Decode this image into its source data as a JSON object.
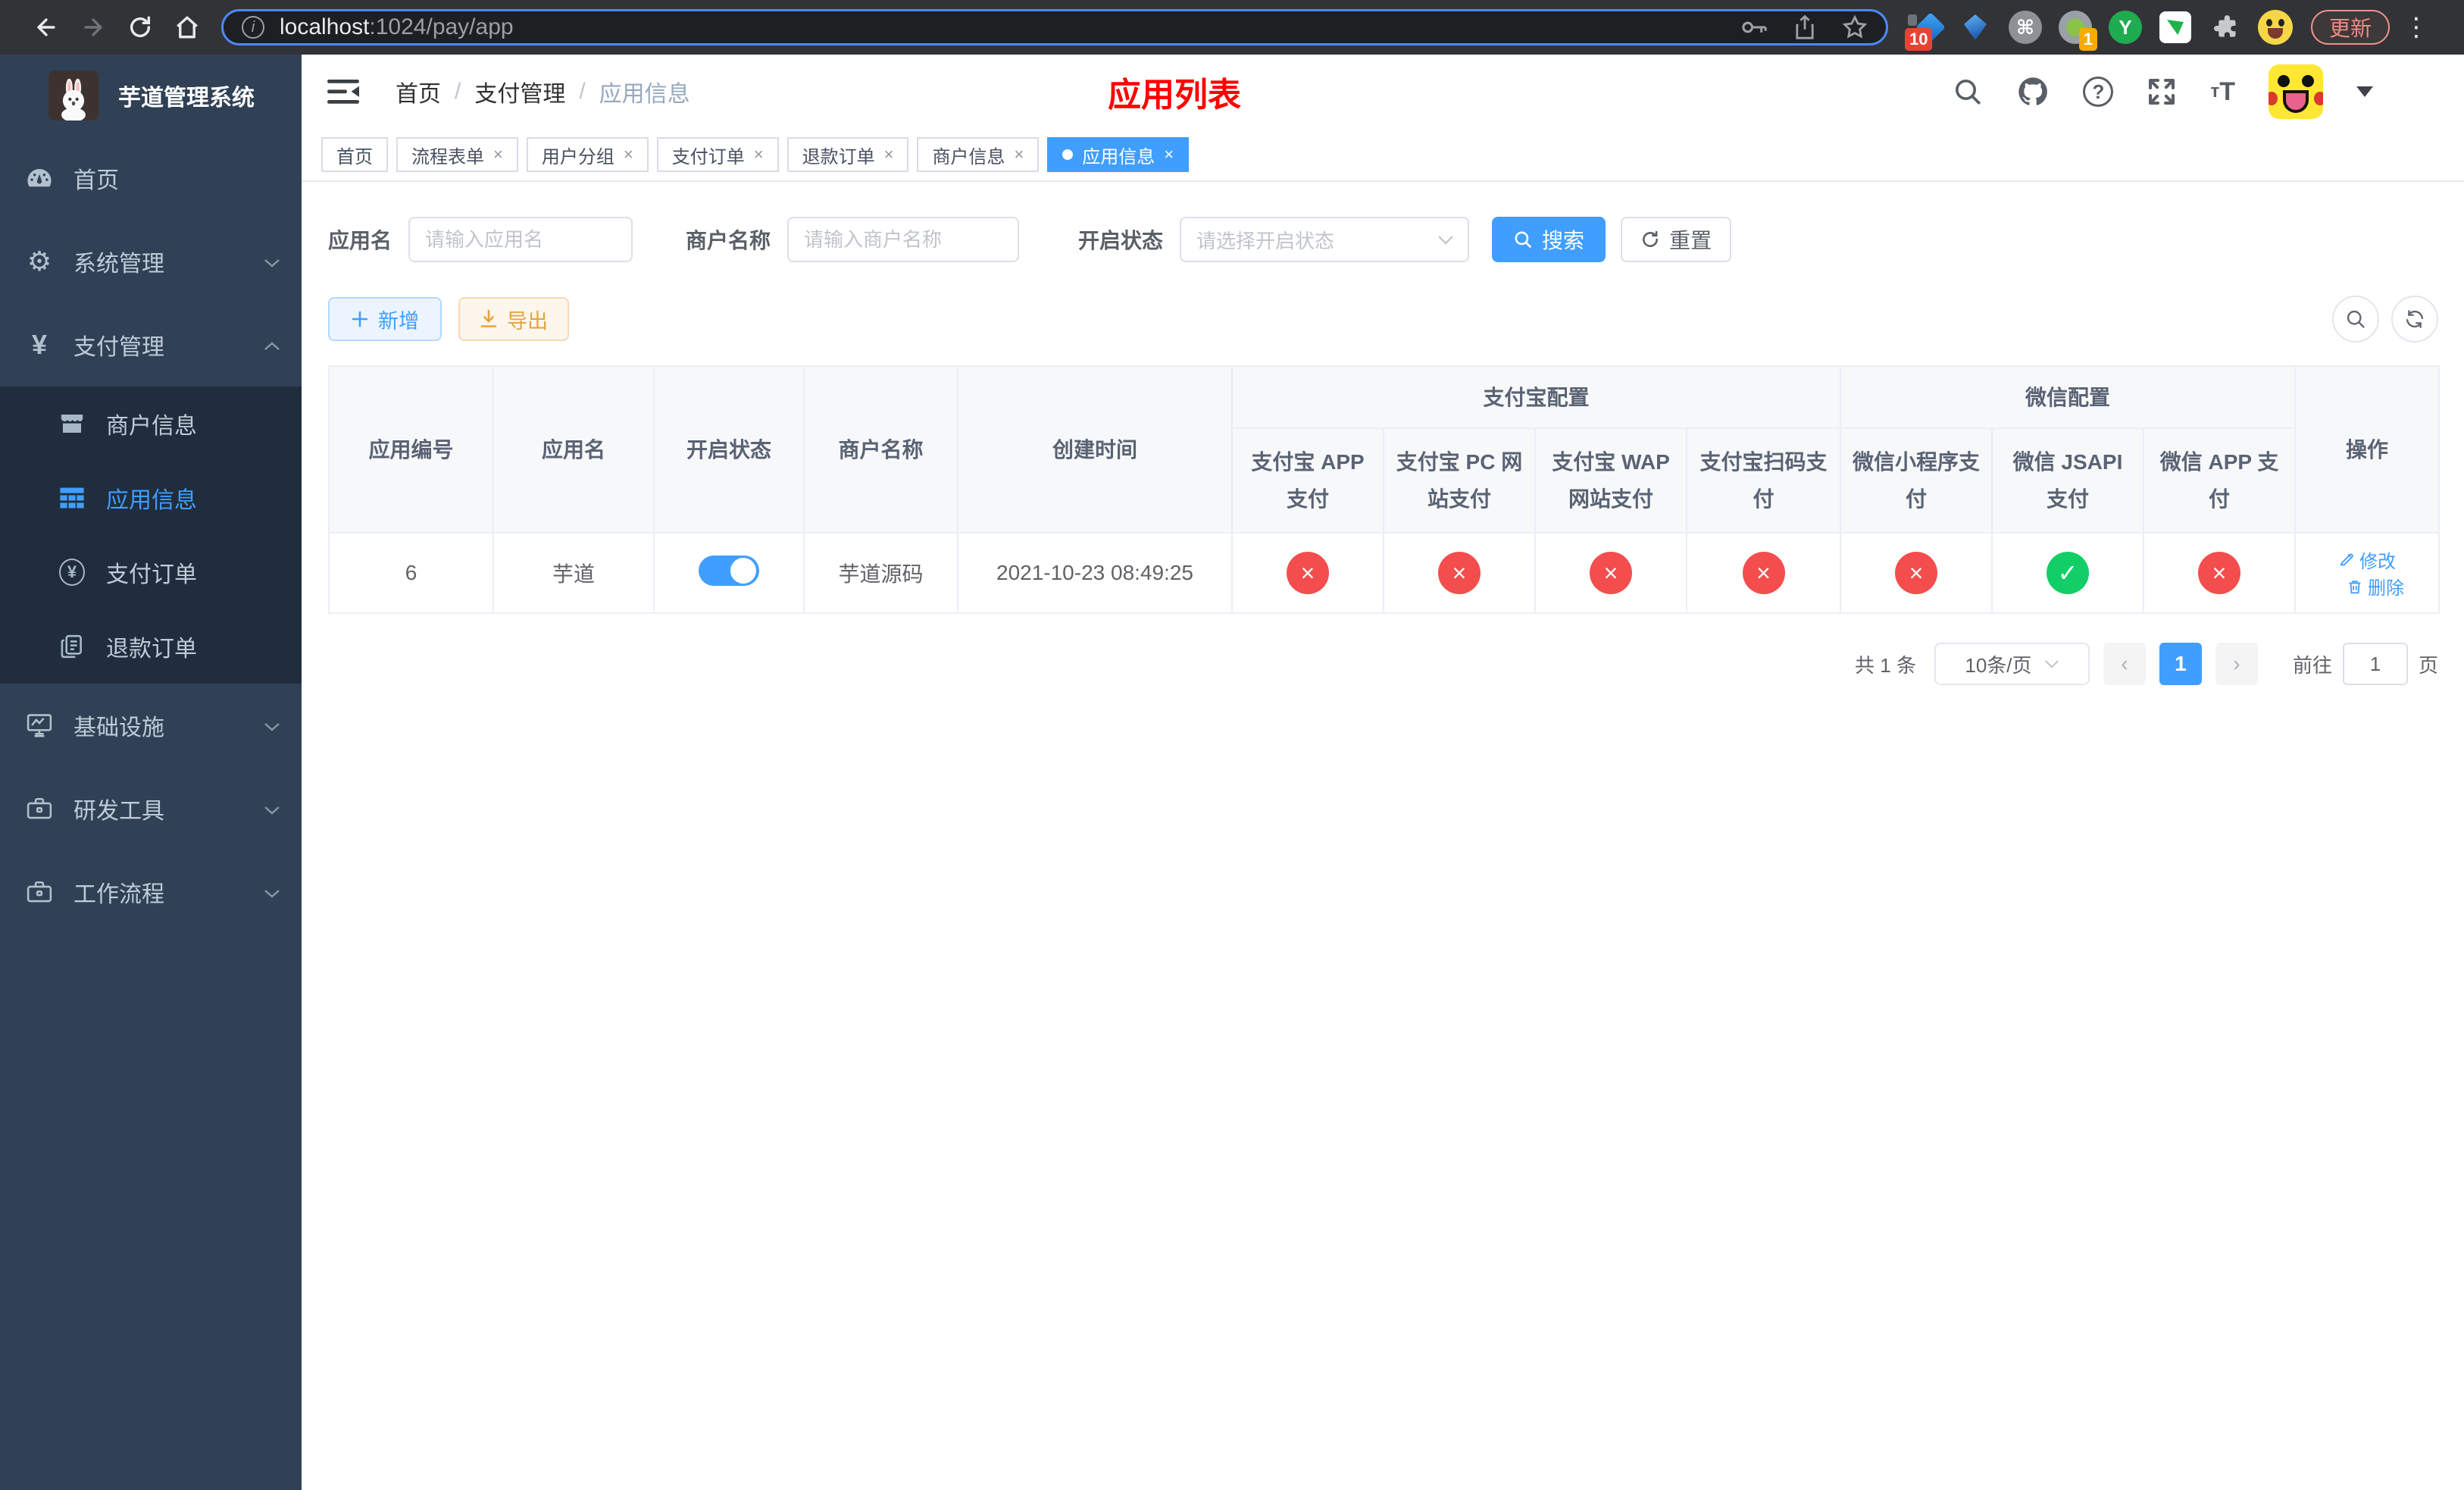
{
  "browser": {
    "url_host": "localhost",
    "url_path": ":1024/pay/app",
    "update_label": "更新",
    "badge_ten": "10",
    "badge_one": "1"
  },
  "sidebar": {
    "title": "芋道管理系统",
    "items": {
      "home": "首页",
      "system": "系统管理",
      "payment": "支付管理",
      "merchant": "商户信息",
      "app_info": "应用信息",
      "pay_order": "支付订单",
      "refund_order": "退款订单",
      "infra": "基础设施",
      "dev_tools": "研发工具",
      "workflow": "工作流程"
    }
  },
  "navbar": {
    "breadcrumb": {
      "home": "首页",
      "payment": "支付管理",
      "current": "应用信息",
      "sep": "/"
    },
    "title": "应用列表"
  },
  "tabs": {
    "items": [
      {
        "label": "首页"
      },
      {
        "label": "流程表单"
      },
      {
        "label": "用户分组"
      },
      {
        "label": "支付订单"
      },
      {
        "label": "退款订单"
      },
      {
        "label": "商户信息"
      },
      {
        "label": "应用信息"
      }
    ],
    "close": "×"
  },
  "filters": {
    "app_name_label": "应用名",
    "app_name_placeholder": "请输入应用名",
    "merchant_label": "商户名称",
    "merchant_placeholder": "请输入商户名称",
    "status_label": "开启状态",
    "status_placeholder": "请选择开启状态",
    "search": "搜索",
    "reset": "重置"
  },
  "toolbar": {
    "add": "新增",
    "export": "导出"
  },
  "table": {
    "groups": {
      "alipay": "支付宝配置",
      "wechat": "微信配置"
    },
    "columns": {
      "app_id": "应用编号",
      "app_name": "应用名",
      "status": "开启状态",
      "merchant": "商户名称",
      "created": "创建时间",
      "alipay_app": "支付宝 APP 支付",
      "alipay_pc": "支付宝 PC 网站支付",
      "alipay_wap": "支付宝 WAP 网站支付",
      "alipay_qr": "支付宝扫码支付",
      "wx_mini": "微信小程序支付",
      "wx_jsapi": "微信 JSAPI 支付",
      "wx_app": "微信 APP 支付",
      "actions": "操作"
    },
    "row": {
      "app_id": "6",
      "app_name": "芋道",
      "enabled": true,
      "merchant": "芋道源码",
      "created": "2021-10-23 08:49:25",
      "statuses": {
        "alipay_app": "fail",
        "alipay_pc": "fail",
        "alipay_wap": "fail",
        "alipay_qr": "fail",
        "wx_mini": "fail",
        "wx_jsapi": "success",
        "wx_app": "fail"
      },
      "edit": "修改",
      "delete": "删除"
    }
  },
  "pagination": {
    "total": "共 1 条",
    "page_size": "10条/页",
    "page": "1",
    "goto_label": "前往",
    "goto_value": "1",
    "page_unit": "页"
  },
  "colors": {
    "primary": "#409eff",
    "danger": "#f34d4d",
    "success": "#13ce66",
    "page_title_red": "#ff0000",
    "sidebar_bg": "#304156",
    "submenu_bg": "#1f2d3d"
  }
}
